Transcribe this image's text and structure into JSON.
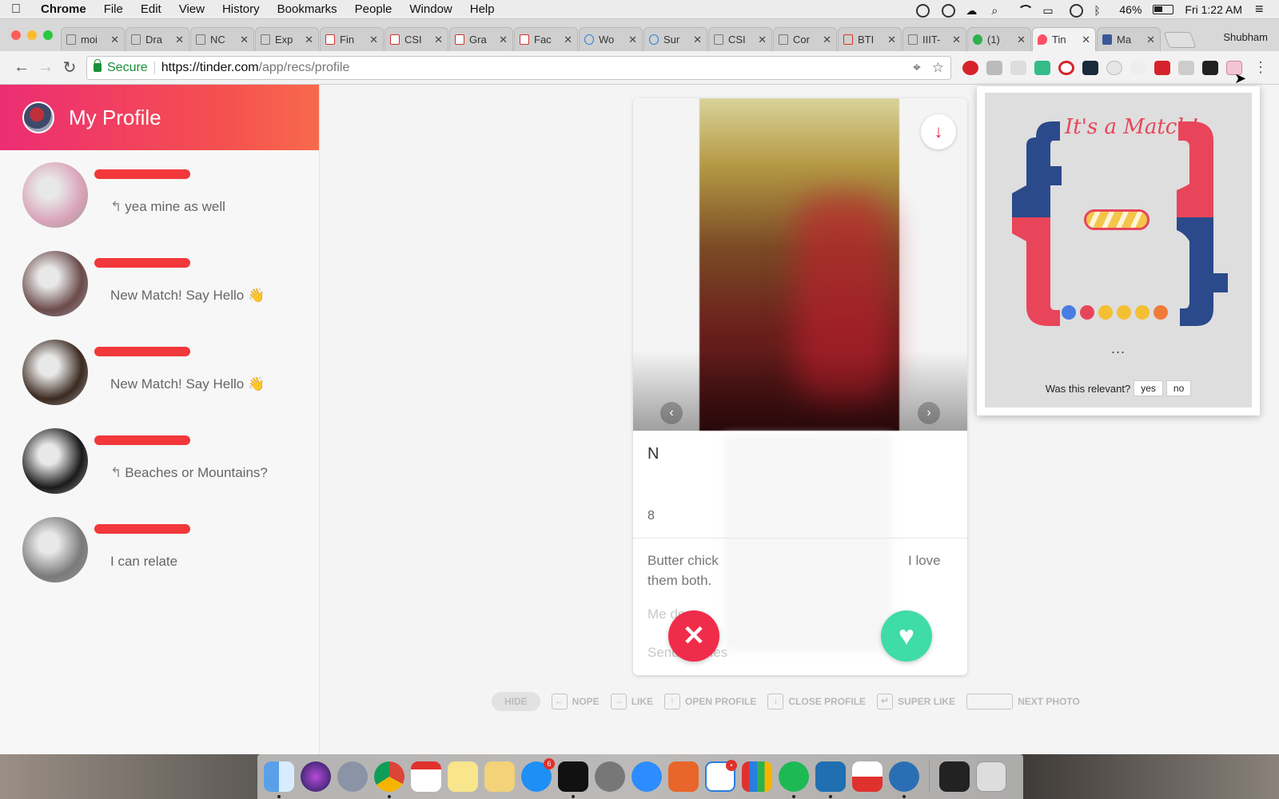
{
  "menubar": {
    "app_name": "Chrome",
    "items": [
      "File",
      "Edit",
      "View",
      "History",
      "Bookmarks",
      "People",
      "Window",
      "Help"
    ],
    "battery": "46%",
    "clock": "Fri 1:22 AM"
  },
  "tabs": [
    {
      "title": "moi",
      "icon": "doc"
    },
    {
      "title": "Dra",
      "icon": "doc"
    },
    {
      "title": "NC",
      "icon": "doc"
    },
    {
      "title": "Exp",
      "icon": "doc"
    },
    {
      "title": "Fin",
      "icon": "red"
    },
    {
      "title": "CSI",
      "icon": "red"
    },
    {
      "title": "Gra",
      "icon": "red"
    },
    {
      "title": "Fac",
      "icon": "red"
    },
    {
      "title": "Wo",
      "icon": "blue"
    },
    {
      "title": "Sur",
      "icon": "blue"
    },
    {
      "title": "CSI",
      "icon": "search"
    },
    {
      "title": "Cor",
      "icon": "doc"
    },
    {
      "title": "BTI",
      "icon": "gmail"
    },
    {
      "title": "IIIT-",
      "icon": "doc"
    },
    {
      "title": "(1)",
      "icon": "green"
    },
    {
      "title": "Tin",
      "icon": "tinder",
      "active": true
    },
    {
      "title": "Ma",
      "icon": "fb"
    }
  ],
  "browser": {
    "profile_name": "Shubham",
    "secure_label": "Secure",
    "url_main": "https://tinder.com",
    "url_path": "/app/recs/profile"
  },
  "sidebar": {
    "title": "My Profile",
    "matches": [
      {
        "preview": "yea mine as well",
        "replied": true,
        "avatar_color": "#d9a3b8"
      },
      {
        "preview": "New Match! Say Hello 👋",
        "replied": false,
        "avatar_color": "#6b4a4a"
      },
      {
        "preview": "New Match! Say Hello 👋",
        "replied": false,
        "avatar_color": "#3b2a20"
      },
      {
        "preview": "Beaches or Mountains?",
        "replied": true,
        "avatar_color": "#1a1a1a"
      },
      {
        "preview": "I can relate",
        "replied": false,
        "avatar_color": "#7a7a7a"
      }
    ]
  },
  "card": {
    "name_initial": "N",
    "age_fragment": "8",
    "bio_line1_left": "Butter chick",
    "bio_line1_right": "I love",
    "bio_line2": "them both.",
    "faded_line1": "Me      de",
    "faded_line2": "Send      memes",
    "nope_symbol": "✕",
    "like_symbol": "♥"
  },
  "shortcuts": {
    "hide": "HIDE",
    "items": [
      {
        "key": "←",
        "label": "NOPE"
      },
      {
        "key": "→",
        "label": "LIKE"
      },
      {
        "key": "↑",
        "label": "OPEN PROFILE"
      },
      {
        "key": "↓",
        "label": "CLOSE PROFILE"
      },
      {
        "key": "↵",
        "label": "SUPER LIKE"
      },
      {
        "key": "",
        "label": "NEXT PHOTO"
      }
    ]
  },
  "popup": {
    "title": "It's a Match!",
    "ellipsis": "...",
    "question": "Was this relevant?",
    "yes": "yes",
    "no": "no"
  },
  "colors": {
    "tinder_gradient_start": "#ec2d73",
    "tinder_gradient_end": "#f86a4c",
    "redaction": "#f2383a",
    "nope": "#ef2d4a",
    "like": "#3fdca7",
    "fb_blue": "#2b4a8b",
    "match_pink": "#e8455a"
  }
}
